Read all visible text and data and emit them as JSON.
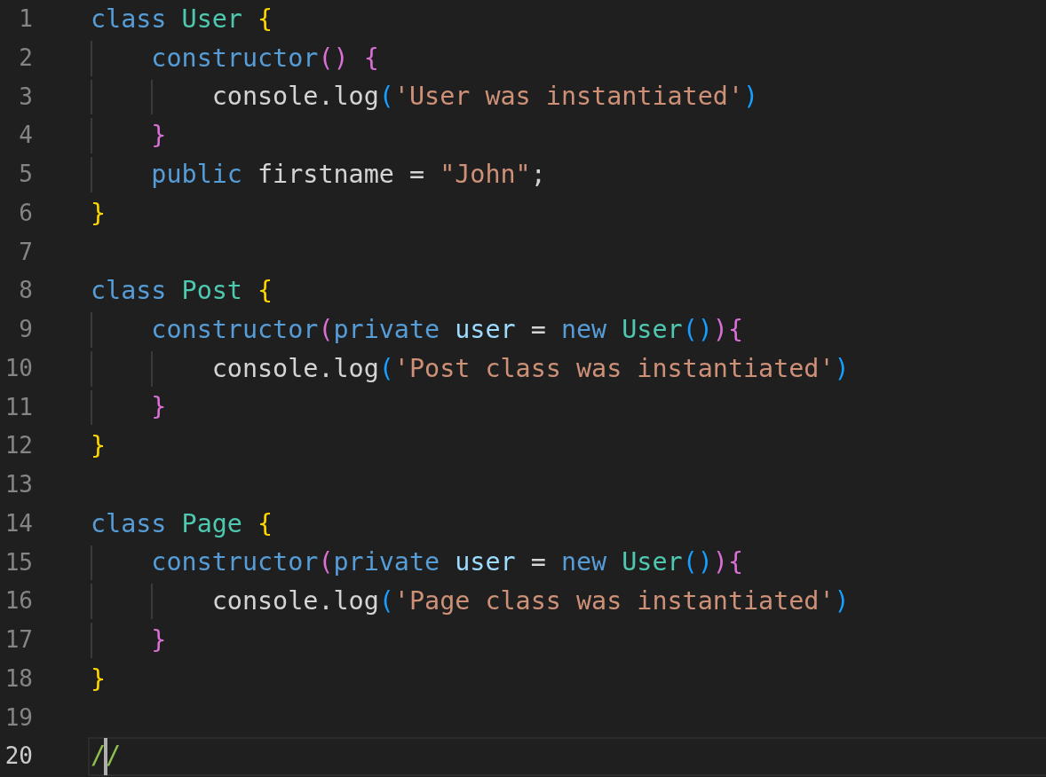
{
  "editor": {
    "lines": [
      {
        "number": "1",
        "current": false,
        "tokens": [
          {
            "kind": "keyword",
            "text": "class "
          },
          {
            "kind": "type",
            "text": "User "
          },
          {
            "kind": "brace1",
            "text": "{"
          }
        ]
      },
      {
        "number": "2",
        "current": false,
        "tokens": [
          {
            "kind": "keyword",
            "text": "    constructor"
          },
          {
            "kind": "brace2",
            "text": "() {"
          }
        ]
      },
      {
        "number": "3",
        "current": false,
        "tokens": [
          {
            "kind": "plain",
            "text": "        console.log"
          },
          {
            "kind": "brace3",
            "text": "("
          },
          {
            "kind": "string",
            "text": "'User was instantiated'"
          },
          {
            "kind": "brace3",
            "text": ")"
          }
        ]
      },
      {
        "number": "4",
        "current": false,
        "tokens": [
          {
            "kind": "brace2",
            "text": "    }"
          }
        ]
      },
      {
        "number": "5",
        "current": false,
        "tokens": [
          {
            "kind": "keyword",
            "text": "    public "
          },
          {
            "kind": "plain",
            "text": "firstname = "
          },
          {
            "kind": "string",
            "text": "\"John\""
          },
          {
            "kind": "plain",
            "text": ";"
          }
        ]
      },
      {
        "number": "6",
        "current": false,
        "tokens": [
          {
            "kind": "brace1",
            "text": "}"
          }
        ]
      },
      {
        "number": "7",
        "current": false
      },
      {
        "number": "8",
        "current": false,
        "tokens": [
          {
            "kind": "keyword",
            "text": "class "
          },
          {
            "kind": "type",
            "text": "Post "
          },
          {
            "kind": "brace1",
            "text": "{"
          }
        ]
      },
      {
        "number": "9",
        "current": false,
        "tokens": [
          {
            "kind": "keyword",
            "text": "    constructor"
          },
          {
            "kind": "brace2",
            "text": "("
          },
          {
            "kind": "keyword",
            "text": "private "
          },
          {
            "kind": "variable",
            "text": "user "
          },
          {
            "kind": "plain",
            "text": "= "
          },
          {
            "kind": "keyword",
            "text": "new "
          },
          {
            "kind": "type",
            "text": "User"
          },
          {
            "kind": "brace3",
            "text": "()"
          },
          {
            "kind": "brace2",
            "text": "){"
          }
        ]
      },
      {
        "number": "10",
        "current": false,
        "tokens": [
          {
            "kind": "plain",
            "text": "        console.log"
          },
          {
            "kind": "brace3",
            "text": "("
          },
          {
            "kind": "string",
            "text": "'Post class was instantiated'"
          },
          {
            "kind": "brace3",
            "text": ")"
          }
        ]
      },
      {
        "number": "11",
        "current": false,
        "tokens": [
          {
            "kind": "brace2",
            "text": "    }"
          }
        ]
      },
      {
        "number": "12",
        "current": false,
        "tokens": [
          {
            "kind": "brace1",
            "text": "}"
          }
        ]
      },
      {
        "number": "13",
        "current": false
      },
      {
        "number": "14",
        "current": false,
        "tokens": [
          {
            "kind": "keyword",
            "text": "class "
          },
          {
            "kind": "type",
            "text": "Page "
          },
          {
            "kind": "brace1",
            "text": "{"
          }
        ]
      },
      {
        "number": "15",
        "current": false,
        "tokens": [
          {
            "kind": "keyword",
            "text": "    constructor"
          },
          {
            "kind": "brace2",
            "text": "("
          },
          {
            "kind": "keyword",
            "text": "private "
          },
          {
            "kind": "variable",
            "text": "user "
          },
          {
            "kind": "plain",
            "text": "= "
          },
          {
            "kind": "keyword",
            "text": "new "
          },
          {
            "kind": "type",
            "text": "User"
          },
          {
            "kind": "brace3",
            "text": "()"
          },
          {
            "kind": "brace2",
            "text": "){"
          }
        ]
      },
      {
        "number": "16",
        "current": false,
        "tokens": [
          {
            "kind": "plain",
            "text": "        console.log"
          },
          {
            "kind": "brace3",
            "text": "("
          },
          {
            "kind": "string",
            "text": "'Page class was instantiated'"
          },
          {
            "kind": "brace3",
            "text": ")"
          }
        ]
      },
      {
        "number": "17",
        "current": false,
        "tokens": [
          {
            "kind": "brace2",
            "text": "    }"
          }
        ]
      },
      {
        "number": "18",
        "current": false,
        "tokens": [
          {
            "kind": "brace1",
            "text": "}"
          }
        ]
      },
      {
        "number": "19",
        "current": false
      },
      {
        "number": "20",
        "current": true,
        "tokens": [
          {
            "kind": "comment",
            "text": "/"
          },
          {
            "kind": "cursor"
          },
          {
            "kind": "comment",
            "text": "/"
          }
        ]
      }
    ]
  }
}
